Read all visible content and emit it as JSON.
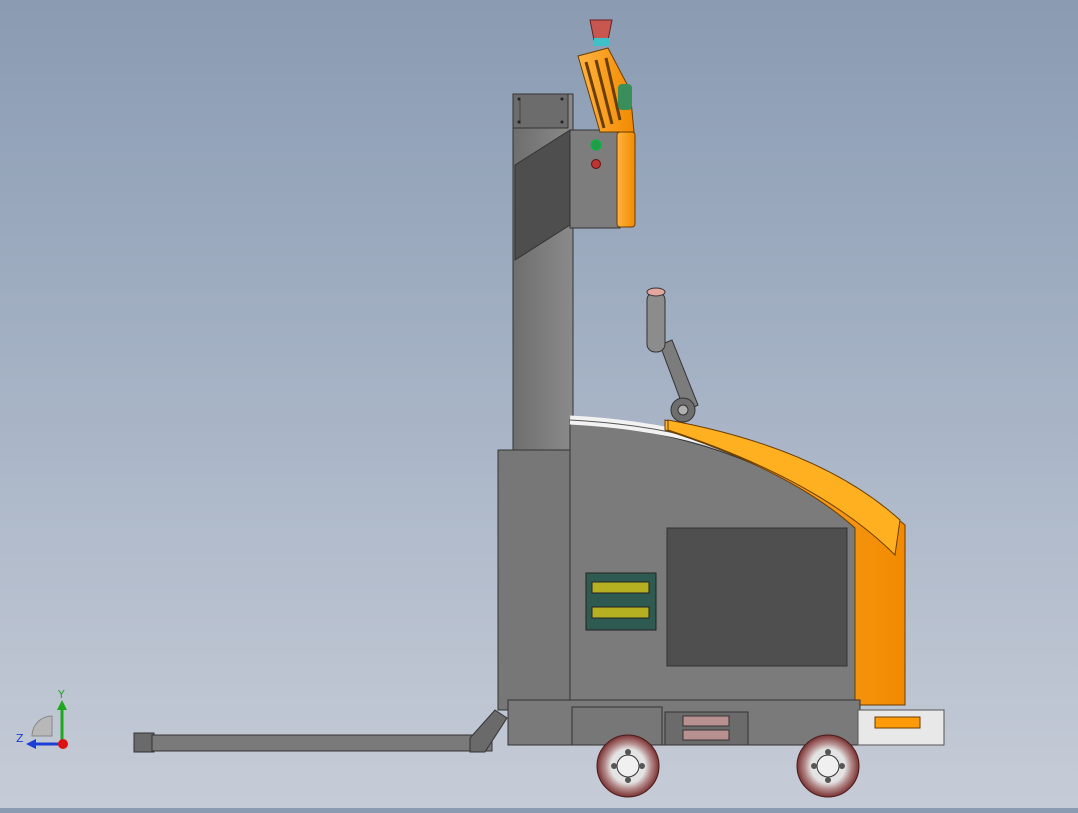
{
  "viewport": {
    "background_top": "#8a9bb2",
    "background_bottom": "#c6ccd7"
  },
  "model": {
    "body_color": "#7a7a7a",
    "accent_color": "#ff9b0a",
    "dark_panel_color": "#4f4f4f",
    "indicator_lamps": [
      "green",
      "red"
    ]
  },
  "triad": {
    "y_label": "Y",
    "z_label": "Z",
    "y_color": "#1ea81e",
    "z_color": "#1a3fd6",
    "x_color": "#d11"
  }
}
